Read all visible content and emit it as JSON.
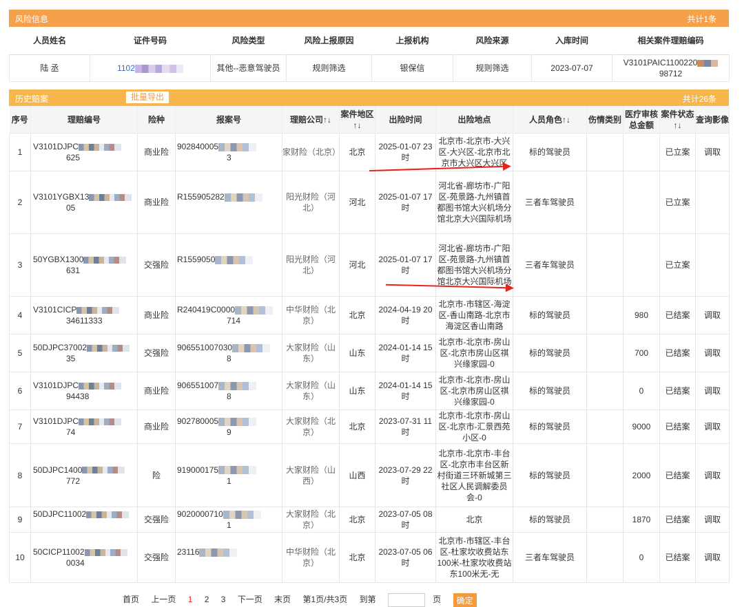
{
  "risk_section": {
    "title": "风险信息",
    "count": "共计1条",
    "headers": [
      "人员姓名",
      "证件号码",
      "风险类型",
      "风险上报原因",
      "上报机构",
      "风险来源",
      "入库时间",
      "相关案件理赔编码"
    ],
    "row": {
      "name": "陆  丞",
      "id_prefix": "1102",
      "risk_type": "其他--恶意驾驶员",
      "reason": "规则筛选",
      "org": "银保信",
      "source": "规则筛选",
      "time": "2023-07-07",
      "claim_code_1": "V3101PAIC1100220",
      "claim_code_2": "98712"
    }
  },
  "history_section": {
    "title": "历史赔案",
    "export_label": "批量导出",
    "count": "共计26条",
    "headers": [
      "序号",
      "理赔编号",
      "险种",
      "报案号",
      "理赔公司↑↓",
      "案件地区↑↓",
      "出险时间",
      "出险地点",
      "人员角色↑↓",
      "伤情类别",
      "医疗审核总金额",
      "案件状态↑↓",
      "查询影像"
    ],
    "rows": [
      {
        "no": "1",
        "claim": "V3101DJPC",
        "claim2": "625",
        "type": "商业险",
        "report": "902840005",
        "report2": "3",
        "company": "家财险（北京）",
        "region": "北京",
        "time": "2025-01-07 23时",
        "place": "北京市-北京市-大兴区-大兴区-北京市北京市大兴区大兴区",
        "role": "标的驾驶员",
        "injury": "",
        "amount": "",
        "status": "已立案",
        "view": "调取"
      },
      {
        "no": "2",
        "claim": "V3101YGBX13",
        "claim2": "05",
        "type": "商业险",
        "report": "R155905282",
        "report2": "",
        "company": "阳光财险（河北）",
        "region": "河北",
        "time": "2025-01-07 17时",
        "place": "河北省-廊坊市-广阳区-苑景路-九州镇首都图书馆大兴机场分馆北京大兴国际机场",
        "role": "三者车驾驶员",
        "injury": "",
        "amount": "",
        "status": "已立案",
        "view": ""
      },
      {
        "no": "3",
        "claim": "50YGBX1300",
        "claim2": "631",
        "type": "交强险",
        "report": "R1559050",
        "report2": "",
        "company": "阳光财险（河北）",
        "region": "河北",
        "time": "2025-01-07 17时",
        "place": "河北省-廊坊市-广阳区-苑景路-九州镇首都图书馆大兴机场分馆北京大兴国际机场",
        "role": "三者车驾驶员",
        "injury": "",
        "amount": "",
        "status": "已立案",
        "view": ""
      },
      {
        "no": "4",
        "claim": "V3101CICP",
        "claim2": "34611333",
        "type": "商业险",
        "report": "R240419C0000",
        "report2": "714",
        "company": "中华财险（北京）",
        "region": "北京",
        "time": "2024-04-19 20时",
        "place": "北京市-市辖区-海淀区-香山南路-北京市海淀区香山南路",
        "role": "标的驾驶员",
        "injury": "",
        "amount": "980",
        "status": "已结案",
        "view": "调取"
      },
      {
        "no": "5",
        "claim": "50DJPC37002",
        "claim2": "35",
        "type": "交强险",
        "report": "906551007030",
        "report2": "8",
        "company": "大家财险（山东）",
        "region": "山东",
        "time": "2024-01-14 15时",
        "place": "北京市-北京市-房山区-北京市房山区祺兴缘家园-0",
        "role": "标的驾驶员",
        "injury": "",
        "amount": "700",
        "status": "已结案",
        "view": "调取"
      },
      {
        "no": "6",
        "claim": "V3101DJPC",
        "claim2": "94438",
        "type": "商业险",
        "report": "906551007",
        "report2": "8",
        "company": "大家财险（山东）",
        "region": "山东",
        "time": "2024-01-14 15时",
        "place": "北京市-北京市-房山区-北京市房山区祺兴缘家园-0",
        "role": "标的驾驶员",
        "injury": "",
        "amount": "0",
        "status": "已结案",
        "view": "调取"
      },
      {
        "no": "7",
        "claim": "V3101DJPC",
        "claim2": "74",
        "type": "商业险",
        "report": "902780005",
        "report2": "9",
        "company": "大家财险（北京）",
        "region": "北京",
        "time": "2023-07-31 11时",
        "place": "北京市-北京市-房山区-北京市-汇景西苑小区-0",
        "role": "标的驾驶员",
        "injury": "",
        "amount": "9000",
        "status": "已结案",
        "view": "调取"
      },
      {
        "no": "8",
        "claim": "50DJPC1400",
        "claim2": "772",
        "type": "险",
        "report": "919000175",
        "report2": "1",
        "company": "大家财险（山西）",
        "region": "山西",
        "time": "2023-07-29 22时",
        "place": "北京市-北京市-丰台区-北京市丰台区新村街道三环新城第三社区人民调解委员会-0",
        "role": "标的驾驶员",
        "injury": "",
        "amount": "2000",
        "status": "已结案",
        "view": "调取"
      },
      {
        "no": "9",
        "claim": "50DJPC11002",
        "claim2": "",
        "type": "交强险",
        "report": "9020000710",
        "report2": "1",
        "company": "大家财险（北京）",
        "region": "北京",
        "time": "2023-07-05 08时",
        "place": "北京",
        "role": "标的驾驶员",
        "injury": "",
        "amount": "1870",
        "status": "已结案",
        "view": "调取"
      },
      {
        "no": "10",
        "claim": "50CICP11002",
        "claim2": "0034",
        "type": "交强险",
        "report": "23116",
        "report2": "",
        "company": "中华财险（北京）",
        "region": "北京",
        "time": "2023-07-05 06时",
        "place": "北京市-市辖区-丰台区-杜家坎收费站东100米-杜家坎收费站东100米无-无",
        "role": "三者车驾驶员",
        "injury": "",
        "amount": "0",
        "status": "已结案",
        "view": "调取"
      }
    ]
  },
  "pager": {
    "first": "首页",
    "prev": "上一页",
    "pages": [
      "1",
      "2",
      "3"
    ],
    "next": "下一页",
    "last": "末页",
    "info": "第1页/共3页",
    "goto": "到第",
    "page_unit": "页",
    "confirm": "确定"
  }
}
